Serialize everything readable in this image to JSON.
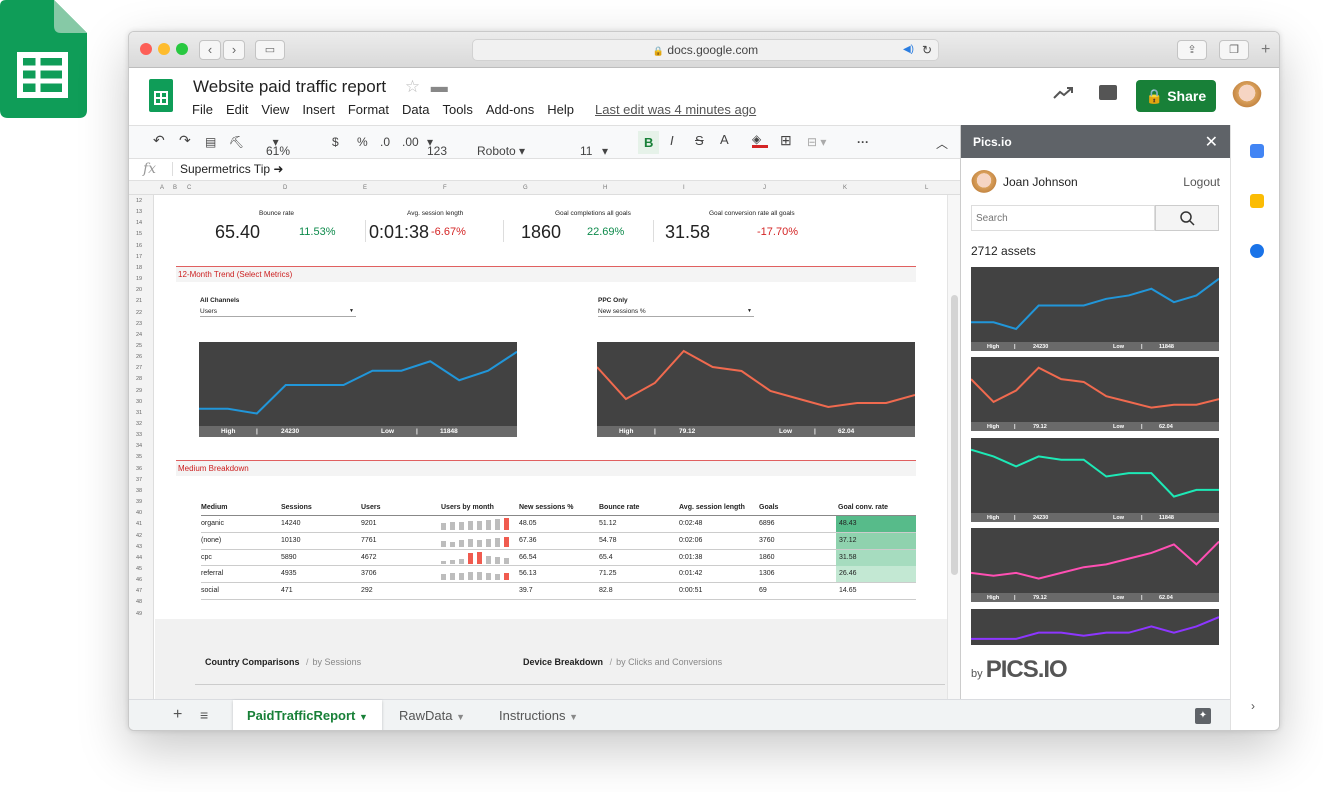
{
  "browser": {
    "url": "docs.google.com"
  },
  "doc": {
    "title": "Website paid traffic report",
    "menu": [
      "File",
      "Edit",
      "View",
      "Insert",
      "Format",
      "Data",
      "Tools",
      "Add-ons",
      "Help"
    ],
    "last_edit": "Last edit was 4 minutes ago",
    "share_label": "Share"
  },
  "toolbar": {
    "zoom": "61%",
    "currency": "$",
    "percent": "%",
    "dec_less": ".0",
    "dec_more": ".00",
    "format": "123",
    "font": "Roboto",
    "size": "11",
    "bold": "B",
    "italic": "I",
    "strike": "S",
    "textcolor": "A"
  },
  "formula": {
    "fx": "fx",
    "content": "Supermetrics Tip  ➜"
  },
  "columns": [
    "A",
    "B",
    "C",
    "D",
    "E",
    "F",
    "G",
    "H",
    "I",
    "J",
    "K",
    "L"
  ],
  "rows": [
    "12",
    "13",
    "14",
    "15",
    "16",
    "17",
    "18",
    "19",
    "20",
    "21",
    "22",
    "23",
    "24",
    "25",
    "26",
    "27",
    "28",
    "29",
    "30",
    "31",
    "32",
    "33",
    "34",
    "35",
    "36",
    "37",
    "38",
    "39",
    "40",
    "41",
    "42",
    "43",
    "44",
    "45",
    "46",
    "47",
    "48",
    "49"
  ],
  "metrics": [
    {
      "label": "Bounce rate",
      "value": "65.40",
      "change": "11.53%",
      "dir": "pos"
    },
    {
      "label": "Avg. session length",
      "value": "0:01:38",
      "change": "-6.67%",
      "dir": "neg"
    },
    {
      "label": "Goal completions all goals",
      "value": "1860",
      "change": "22.69%",
      "dir": "pos"
    },
    {
      "label": "Goal conversion rate all goals",
      "value": "31.58",
      "change": "-17.70%",
      "dir": "neg"
    }
  ],
  "trend": {
    "title": "12-Month Trend (Select Metrics)",
    "left": {
      "label": "All Channels",
      "select": "Users",
      "high_label": "High",
      "high": "24230",
      "low_label": "Low",
      "low": "11848",
      "color": "#2196d9",
      "values": [
        3,
        3,
        2,
        8,
        8,
        8,
        11,
        11,
        13,
        9,
        11,
        15
      ]
    },
    "right": {
      "label": "PPC Only",
      "select": "New sessions %",
      "high_label": "High",
      "high": "79.12",
      "low_label": "Low",
      "low": "62.04",
      "color": "#f06a4f",
      "values": [
        14,
        6,
        10,
        18,
        14,
        13,
        8,
        6,
        4,
        5,
        5,
        7
      ]
    }
  },
  "breakdown": {
    "title": "Medium Breakdown",
    "headers": [
      "Medium",
      "Sessions",
      "Users",
      "Users by month",
      "New sessions %",
      "Bounce rate",
      "Avg. session length",
      "Goals",
      "Goal conv. rate"
    ],
    "rows": [
      [
        "organic",
        "14240",
        "9201",
        "",
        "48.05",
        "51.12",
        "0:02:48",
        "6896",
        "48.43"
      ],
      [
        "(none)",
        "10130",
        "7761",
        "",
        "67.36",
        "54.78",
        "0:02:06",
        "3760",
        "37.12"
      ],
      [
        "cpc",
        "5890",
        "4672",
        "",
        "66.54",
        "65.4",
        "0:01:38",
        "1860",
        "31.58"
      ],
      [
        "referral",
        "4935",
        "3706",
        "",
        "56.13",
        "71.25",
        "0:01:42",
        "1306",
        "26.46"
      ],
      [
        "social",
        "471",
        "292",
        "",
        "39.7",
        "82.8",
        "0:00:51",
        "69",
        "14.65"
      ]
    ],
    "goal_colors": [
      "#57bb8a",
      "#8fd2ae",
      "#a6dcbf",
      "#c3e8d3",
      "#ffffff"
    ]
  },
  "bottom": {
    "country": "Country Comparisons",
    "country_sub": "by Sessions",
    "device": "Device Breakdown",
    "device_sub": "by Clicks and Conversions"
  },
  "tabs": [
    "PaidTrafficReport",
    "RawData",
    "Instructions"
  ],
  "panel": {
    "title": "Pics.io",
    "user": "Joan Johnson",
    "logout": "Logout",
    "search_placeholder": "Search",
    "assets": "2712 assets",
    "by": "by",
    "brand": "PICS.IO",
    "thumbs": [
      {
        "color": "#2196d9",
        "high": "24230",
        "low": "11848",
        "high_label": "High",
        "low_label": "Low",
        "values": [
          5,
          5,
          3,
          10,
          10,
          10,
          12,
          13,
          15,
          11,
          13,
          18
        ]
      },
      {
        "color": "#f06a4f",
        "high": "79.12",
        "low": "62.04",
        "high_label": "High",
        "low_label": "Low",
        "values": [
          14,
          6,
          10,
          18,
          14,
          13,
          8,
          6,
          4,
          5,
          5,
          7
        ]
      },
      {
        "color": "#1de9b6",
        "high": "24230",
        "low": "11848",
        "high_label": "High",
        "low_label": "Low",
        "values": [
          18,
          16,
          13,
          16,
          15,
          15,
          10,
          11,
          11,
          4,
          6,
          6
        ]
      },
      {
        "color": "#ff4fb3",
        "high": "79.12",
        "low": "62.04",
        "high_label": "High",
        "low_label": "Low",
        "values": [
          6,
          5,
          6,
          4,
          6,
          8,
          9,
          11,
          13,
          16,
          9,
          17
        ]
      },
      {
        "color": "#8d36ff",
        "high": "",
        "low": "",
        "high_label": "",
        "low_label": "",
        "values": [
          1,
          1,
          1,
          3,
          3,
          2,
          3,
          3,
          5,
          3,
          5,
          8
        ]
      }
    ]
  }
}
